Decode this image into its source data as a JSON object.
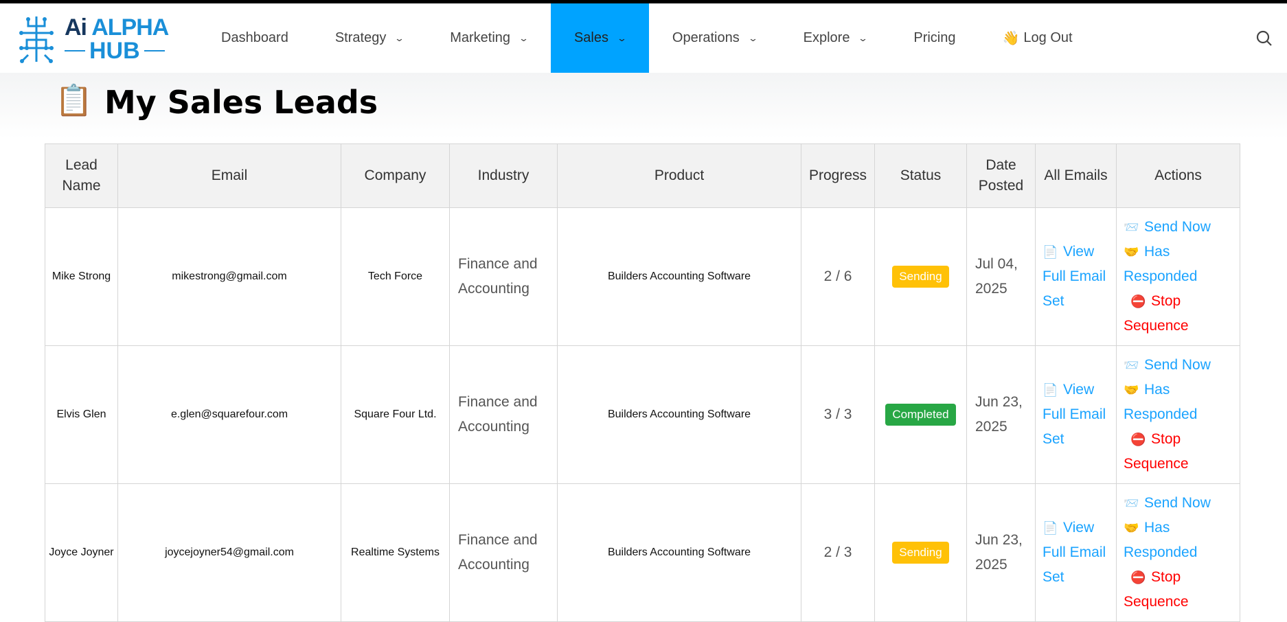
{
  "logo": {
    "text_ai": "Ai",
    "text_alpha": "ALPHA",
    "text_hub": "HUB"
  },
  "nav": [
    {
      "label": "Dashboard",
      "dropdown": false
    },
    {
      "label": "Strategy",
      "dropdown": true
    },
    {
      "label": "Marketing",
      "dropdown": true
    },
    {
      "label": "Sales",
      "dropdown": true,
      "active": true
    },
    {
      "label": "Operations",
      "dropdown": true
    },
    {
      "label": "Explore",
      "dropdown": true
    },
    {
      "label": "Pricing",
      "dropdown": false
    },
    {
      "label": "Log Out",
      "icon": "👋"
    }
  ],
  "page": {
    "title": "My Sales Leads",
    "icon": "📋"
  },
  "table": {
    "headers": [
      "Lead Name",
      "Email",
      "Company",
      "Industry",
      "Product",
      "Progress",
      "Status",
      "Date Posted",
      "All Emails",
      "Actions"
    ],
    "view_label": "View Full Email Set",
    "actions": {
      "send": "Send Now",
      "responded": "Has Responded",
      "stop": "Stop Sequence"
    },
    "rows": [
      {
        "name": "Mike Strong",
        "email": "mikestrong@gmail.com",
        "company": "Tech Force",
        "industry": "Finance and Accounting",
        "product": "Builders Accounting Software",
        "progress": "2 / 6",
        "status": "Sending",
        "date": "Jul 04, 2025"
      },
      {
        "name": "Elvis Glen",
        "email": "e.glen@squarefour.com",
        "company": "Square Four Ltd.",
        "industry": "Finance and Accounting",
        "product": "Builders Accounting Software",
        "progress": "3 / 3",
        "status": "Completed",
        "date": "Jun 23, 2025"
      },
      {
        "name": "Joyce Joyner",
        "email": "joycejoyner54@gmail.com",
        "company": "Realtime Systems",
        "industry": "Finance and Accounting",
        "product": "Builders Accounting Software",
        "progress": "2 / 3",
        "status": "Sending",
        "date": "Jun 23, 2025"
      }
    ]
  },
  "colors": {
    "accent": "#00a3ff",
    "sending": "#ffc107",
    "completed": "#28a745",
    "link": "#1aa3ff",
    "stop": "#ff0000"
  }
}
